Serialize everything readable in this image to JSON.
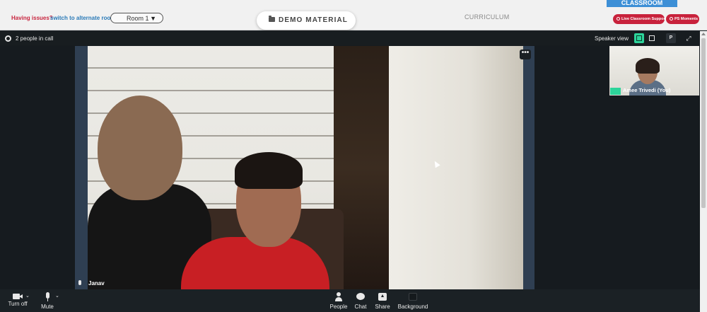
{
  "topbar": {
    "having_issues": "Having issues?",
    "alternate_room": "switch to alternate room",
    "room_selected": "Room 1",
    "demo_material": "DEMO MATERIAL",
    "curriculum": "CURRICULUM",
    "classroom_tab": "CLASSROOM",
    "live_support": "Live Classroom Support",
    "ps_moments": "PS Moments"
  },
  "meeting": {
    "people_count": "2 people in call",
    "speaker_view": "Speaker view",
    "p_label": "P",
    "more_label": "•••",
    "main_participant": "Janav",
    "self_participant": "Amee Trivedi (You)"
  },
  "toolbar": {
    "turn_off": "Turn off",
    "mute": "Mute",
    "people": "People",
    "chat": "Chat",
    "share": "Share",
    "background": "Background"
  },
  "colors": {
    "accent_green": "#2dd49a",
    "alert_red": "#c8223c",
    "link_blue": "#2a7ab8",
    "classroom_blue": "#3d8fd6"
  },
  "icons": [
    "settings-gear-icon",
    "speaker-view-icon",
    "grid-view-icon",
    "expand-icon",
    "more-icon",
    "mic-icon",
    "camera-icon",
    "people-icon",
    "chat-icon",
    "share-screen-icon",
    "background-icon",
    "folder-icon",
    "chevron-down-icon"
  ]
}
